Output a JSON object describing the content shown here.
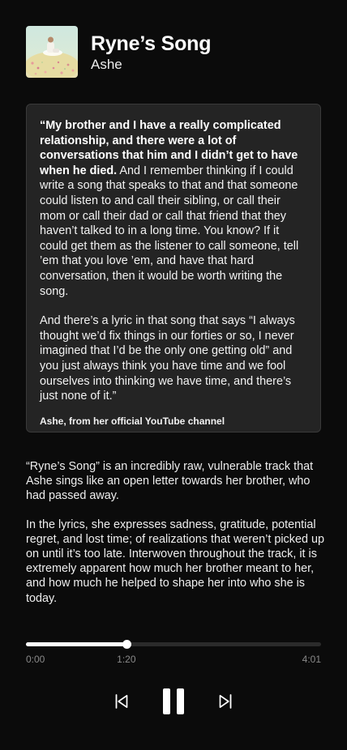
{
  "song": {
    "title": "Ryne’s Song",
    "artist": "Ashe",
    "album_art_icon": "album-cover-art"
  },
  "quote": {
    "bold_intro": "“My brother and I have a really complicated relationship, and there were a lot of conversations that him and I didn’t get to have when he died.",
    "paragraph1_rest": " And I remember thinking if I could write a song that speaks to that and that someone could listen to and call their sibling, or call their mom or call their dad or call that friend that they haven’t talked to in a long time. You know? If it could get them as the listener to call someone, tell ’em that you love ’em, and have that hard conversation, then it would be worth writing the song.",
    "paragraph2": "And there’s a lyric in that song that says “I always thought we’d fix things in our forties or so, I never imagined that I’d be the only one getting old” and you just always think you have time and we fool ourselves into thinking we have time, and there’s just none of it.”",
    "attribution": "Ashe, from her official YouTube channel"
  },
  "description": {
    "paragraph1": "“Ryne’s Song” is an incredibly raw, vulnerable track that Ashe sings like an open letter towards her brother, who had passed away.",
    "paragraph2": "In the lyrics, she expresses sadness, gratitude, potential regret, and lost time; of realizations that weren’t picked up on until it’s too late. Interwoven throughout the track, it is extremely apparent how much her brother meant to her, and how much he helped to shape her into who she is today."
  },
  "player": {
    "start_time": "0:00",
    "current_time": "1:20",
    "total_time": "4:01",
    "progress_fraction": 0.3402,
    "controls": {
      "previous_icon": "skip-previous-icon",
      "pause_icon": "pause-icon",
      "next_icon": "skip-next-icon"
    }
  },
  "colors": {
    "background": "#0b0b0b",
    "card": "#242424",
    "track": "#2b2b2b",
    "accent": "#ffffff",
    "muted_text": "#8a8a8a"
  }
}
